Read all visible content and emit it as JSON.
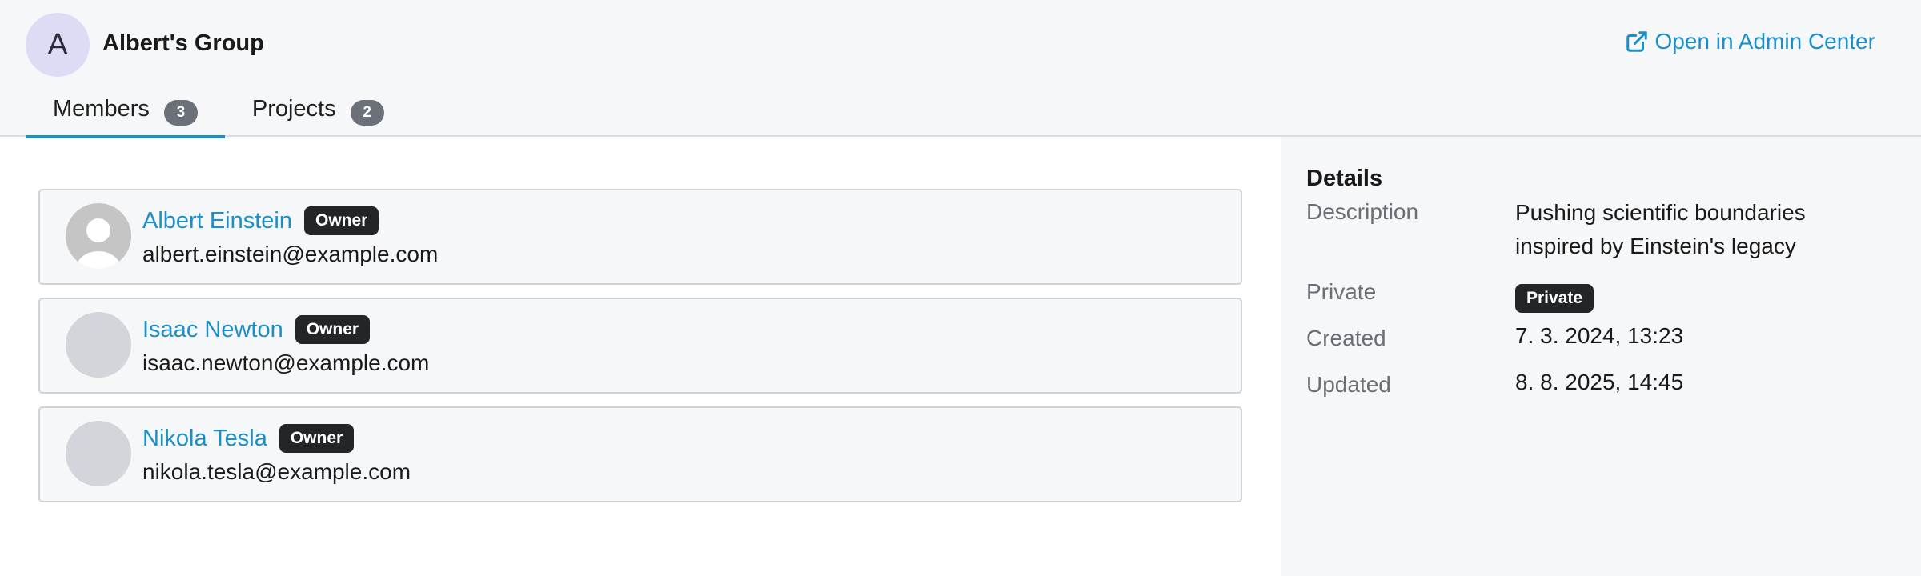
{
  "group": {
    "avatar_letter": "A",
    "title": "Albert's Group",
    "admin_link_label": "Open in Admin Center"
  },
  "tabs": [
    {
      "label": "Members",
      "count": "3",
      "active": true
    },
    {
      "label": "Projects",
      "count": "2",
      "active": false
    }
  ],
  "members": [
    {
      "name": "Albert Einstein",
      "role": "Owner",
      "email": "albert.einstein@example.com",
      "avatar": "default-user-photo"
    },
    {
      "name": "Isaac Newton",
      "role": "Owner",
      "email": "isaac.newton@example.com",
      "avatar": "blank"
    },
    {
      "name": "Nikola Tesla",
      "role": "Owner",
      "email": "nikola.tesla@example.com",
      "avatar": "blank"
    }
  ],
  "details": {
    "title": "Details",
    "description_label": "Description",
    "description_line1": "Pushing scientific boundaries",
    "description_line2": "inspired by Einstein's legacy",
    "private_label": "Private",
    "private_badge": "Private",
    "created_label": "Created",
    "created_value": "7. 3. 2024, 13:23",
    "updated_label": "Updated",
    "updated_value": "8. 8. 2025, 14:45"
  },
  "colors": {
    "accent": "#1a8fc9",
    "badge_dark": "#232529",
    "count_badge": "#6b7079",
    "panel_bg": "#f6f7f9",
    "group_avatar_bg": "#dcdcf4"
  },
  "icons": {
    "admin_link": "external-link-icon"
  }
}
